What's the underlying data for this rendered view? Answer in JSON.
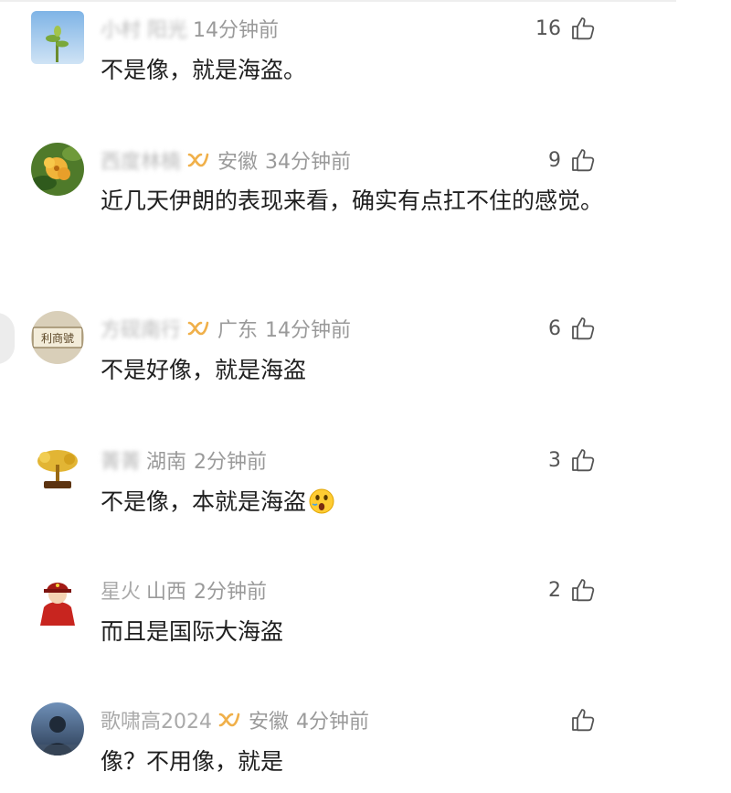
{
  "comments": [
    {
      "username": "小村 阳光",
      "username_blurred": true,
      "vip": false,
      "region": "",
      "time": "14分钟前",
      "likes": "16",
      "text": "不是像，就是海盗。",
      "avatar": "plant-photo-avatar"
    },
    {
      "username": "西度林楠",
      "username_blurred": true,
      "vip": true,
      "region": "安徽",
      "time": "34分钟前",
      "likes": "9",
      "text": "近几天伊朗的表现来看，确实有点扛不住的感觉。",
      "avatar": "yellow-flower-avatar"
    },
    {
      "username": "方砚南行",
      "username_blurred": true,
      "vip": true,
      "region": "广东",
      "time": "14分钟前",
      "likes": "6",
      "text": "不是好像，就是海盗",
      "avatar": "calligraphy-plaque-avatar"
    },
    {
      "username": "菁菁",
      "username_blurred": true,
      "vip": false,
      "region": "湖南",
      "time": "2分钟前",
      "likes": "3",
      "text": "不是像，本就是海盗",
      "emoji": "shocked-face-emoji",
      "avatar": "golden-bonsai-avatar"
    },
    {
      "username": "星火",
      "username_blurred": false,
      "vip": false,
      "region": "山西",
      "time": "2分钟前",
      "likes": "2",
      "text": "而且是国际大海盗",
      "avatar": "red-soldier-avatar"
    },
    {
      "username": "歌啸高2024",
      "username_blurred": false,
      "vip": true,
      "region": "安徽",
      "time": "4分钟前",
      "likes": "",
      "text": "像？不用像，就是",
      "avatar": "figure-portrait-avatar"
    }
  ],
  "colors": {
    "meta_gray": "#9a9a9a",
    "vip_gold": "#f0b04a",
    "text_dark": "#1f1f1f"
  }
}
